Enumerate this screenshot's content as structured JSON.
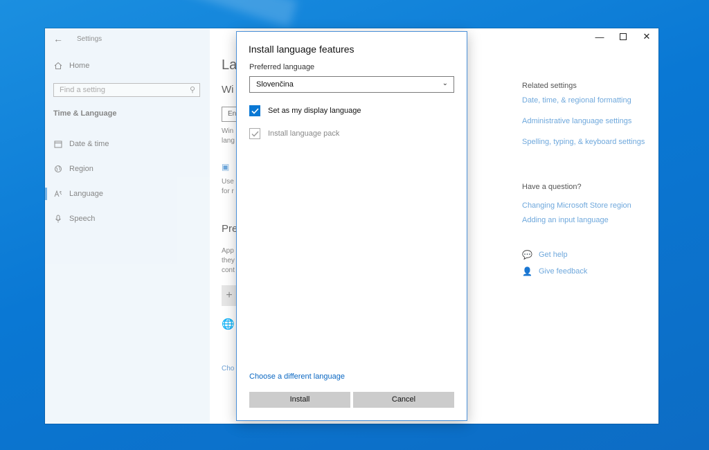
{
  "window": {
    "title": "Settings"
  },
  "sidebar": {
    "home_label": "Home",
    "search_placeholder": "Find a setting",
    "section_title": "Time & Language",
    "items": [
      {
        "label": "Date & time",
        "icon": "calendar-icon"
      },
      {
        "label": "Region",
        "icon": "globe-icon"
      },
      {
        "label": "Language",
        "icon": "language-icon"
      },
      {
        "label": "Speech",
        "icon": "microphone-icon"
      }
    ]
  },
  "main_peek": {
    "heading": "La",
    "subheading": "Wi",
    "box_text": "En",
    "text1_line1": "Win",
    "text1_line2": "lang",
    "text2_line1": "Use",
    "text2_line2": "for r",
    "heading2": "Pre",
    "text3_line1": "App",
    "text3_line2": "they",
    "text3_line3": "cont",
    "add_symbol": "+",
    "link": "Cho"
  },
  "related": {
    "heading": "Related settings",
    "links": [
      "Date, time, & regional formatting",
      "Administrative language settings",
      "Spelling, typing, & keyboard settings"
    ],
    "question_heading": "Have a question?",
    "question_links": [
      "Changing Microsoft Store region",
      "Adding an input language"
    ],
    "get_help": "Get help",
    "give_feedback": "Give feedback"
  },
  "dialog": {
    "title": "Install language features",
    "preferred_label": "Preferred language",
    "selected_language": "Slovenčina",
    "checkbox_display": {
      "label": "Set as my display language",
      "checked": true
    },
    "checkbox_pack": {
      "label": "Install language pack",
      "checked": true,
      "disabled": true
    },
    "link": "Choose a different language",
    "install_label": "Install",
    "cancel_label": "Cancel"
  },
  "colors": {
    "accent": "#0a78d4",
    "desktop": "#0a78d4",
    "sidebar_bg": "#e5f0f8"
  }
}
